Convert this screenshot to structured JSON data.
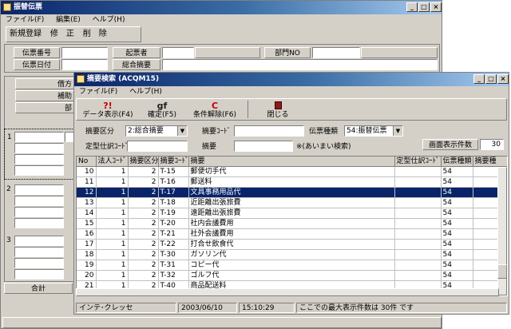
{
  "main_window": {
    "title": "振替伝票",
    "menu": [
      "ファイル(F)",
      "編集(E)",
      "ヘルプ(H)"
    ],
    "toolbar": [
      "新規登録",
      "修　正",
      "削　除"
    ],
    "fields": {
      "voucher_no": "伝票番号",
      "voucher_date": "伝票日付",
      "issuer": "起票者",
      "dept_no": "部門NO",
      "summary": "総合摘要"
    },
    "grid_headers": [
      "借方",
      "補助",
      "部"
    ],
    "row_numbers": [
      "1",
      "2",
      "3"
    ],
    "total_label": "合計"
  },
  "dialog": {
    "title": "摘要検索 (ACQM15)",
    "menu": [
      "ファイル(F)",
      "ヘルプ(H)"
    ],
    "toolbar": [
      {
        "label": "データ表示(F4)",
        "icon": "?!"
      },
      {
        "label": "確定(F5)",
        "icon": "gf"
      },
      {
        "label": "条件解除(F6)",
        "icon": "C"
      },
      {
        "label": "閉じる",
        "icon": "door"
      }
    ],
    "filters": {
      "summary_type_label": "摘要区分",
      "summary_type_value": "2:総合摘要",
      "summary_code_label": "摘要ｺｰﾄﾞ",
      "summary_code_value": "",
      "voucher_type_label": "伝票種類",
      "voucher_type_value": "54:振替伝票",
      "journal_code_label": "定型仕訳ｺｰﾄﾞ",
      "journal_code_value": "",
      "summary_label": "摘要",
      "summary_value": "",
      "fuzzy_note": "※(あいまい検索)",
      "display_count_label": "画面表示件数",
      "display_count_value": "30"
    },
    "table": {
      "headers": [
        "No",
        "法人ｺｰﾄﾞ",
        "摘要区分",
        "摘要ｺｰﾄﾞ",
        "摘要",
        "定型仕訳ｺｰﾄﾞ",
        "伝票種類",
        "摘要種"
      ],
      "rows": [
        [
          "10",
          "1",
          "2",
          "T-15",
          "郵便切手代",
          "",
          "54",
          ""
        ],
        [
          "11",
          "1",
          "2",
          "T-16",
          "郵送料",
          "",
          "54",
          ""
        ],
        [
          "12",
          "1",
          "2",
          "T-17",
          "文具事務用品代",
          "",
          "54",
          ""
        ],
        [
          "13",
          "1",
          "2",
          "T-18",
          "近距離出張旅費",
          "",
          "54",
          ""
        ],
        [
          "14",
          "1",
          "2",
          "T-19",
          "遠距離出張旅費",
          "",
          "54",
          ""
        ],
        [
          "15",
          "1",
          "2",
          "T-20",
          "社内会議費用",
          "",
          "54",
          ""
        ],
        [
          "16",
          "1",
          "2",
          "T-21",
          "社外会議費用",
          "",
          "54",
          ""
        ],
        [
          "17",
          "1",
          "2",
          "T-22",
          "打合せ飲食代",
          "",
          "54",
          ""
        ],
        [
          "18",
          "1",
          "2",
          "T-30",
          "ガソリン代",
          "",
          "54",
          ""
        ],
        [
          "19",
          "1",
          "2",
          "T-31",
          "コピー代",
          "",
          "54",
          ""
        ],
        [
          "20",
          "1",
          "2",
          "T-32",
          "ゴルフ代",
          "",
          "54",
          ""
        ],
        [
          "21",
          "1",
          "2",
          "T-40",
          "商品配送料",
          "",
          "54",
          ""
        ]
      ],
      "selected_row": 2
    },
    "statusbar": {
      "user": "インテ･クレッセ",
      "date": "2003/06/10",
      "time": "15:10:29",
      "message": "ここでの最大表示件数は 30件 です"
    }
  }
}
